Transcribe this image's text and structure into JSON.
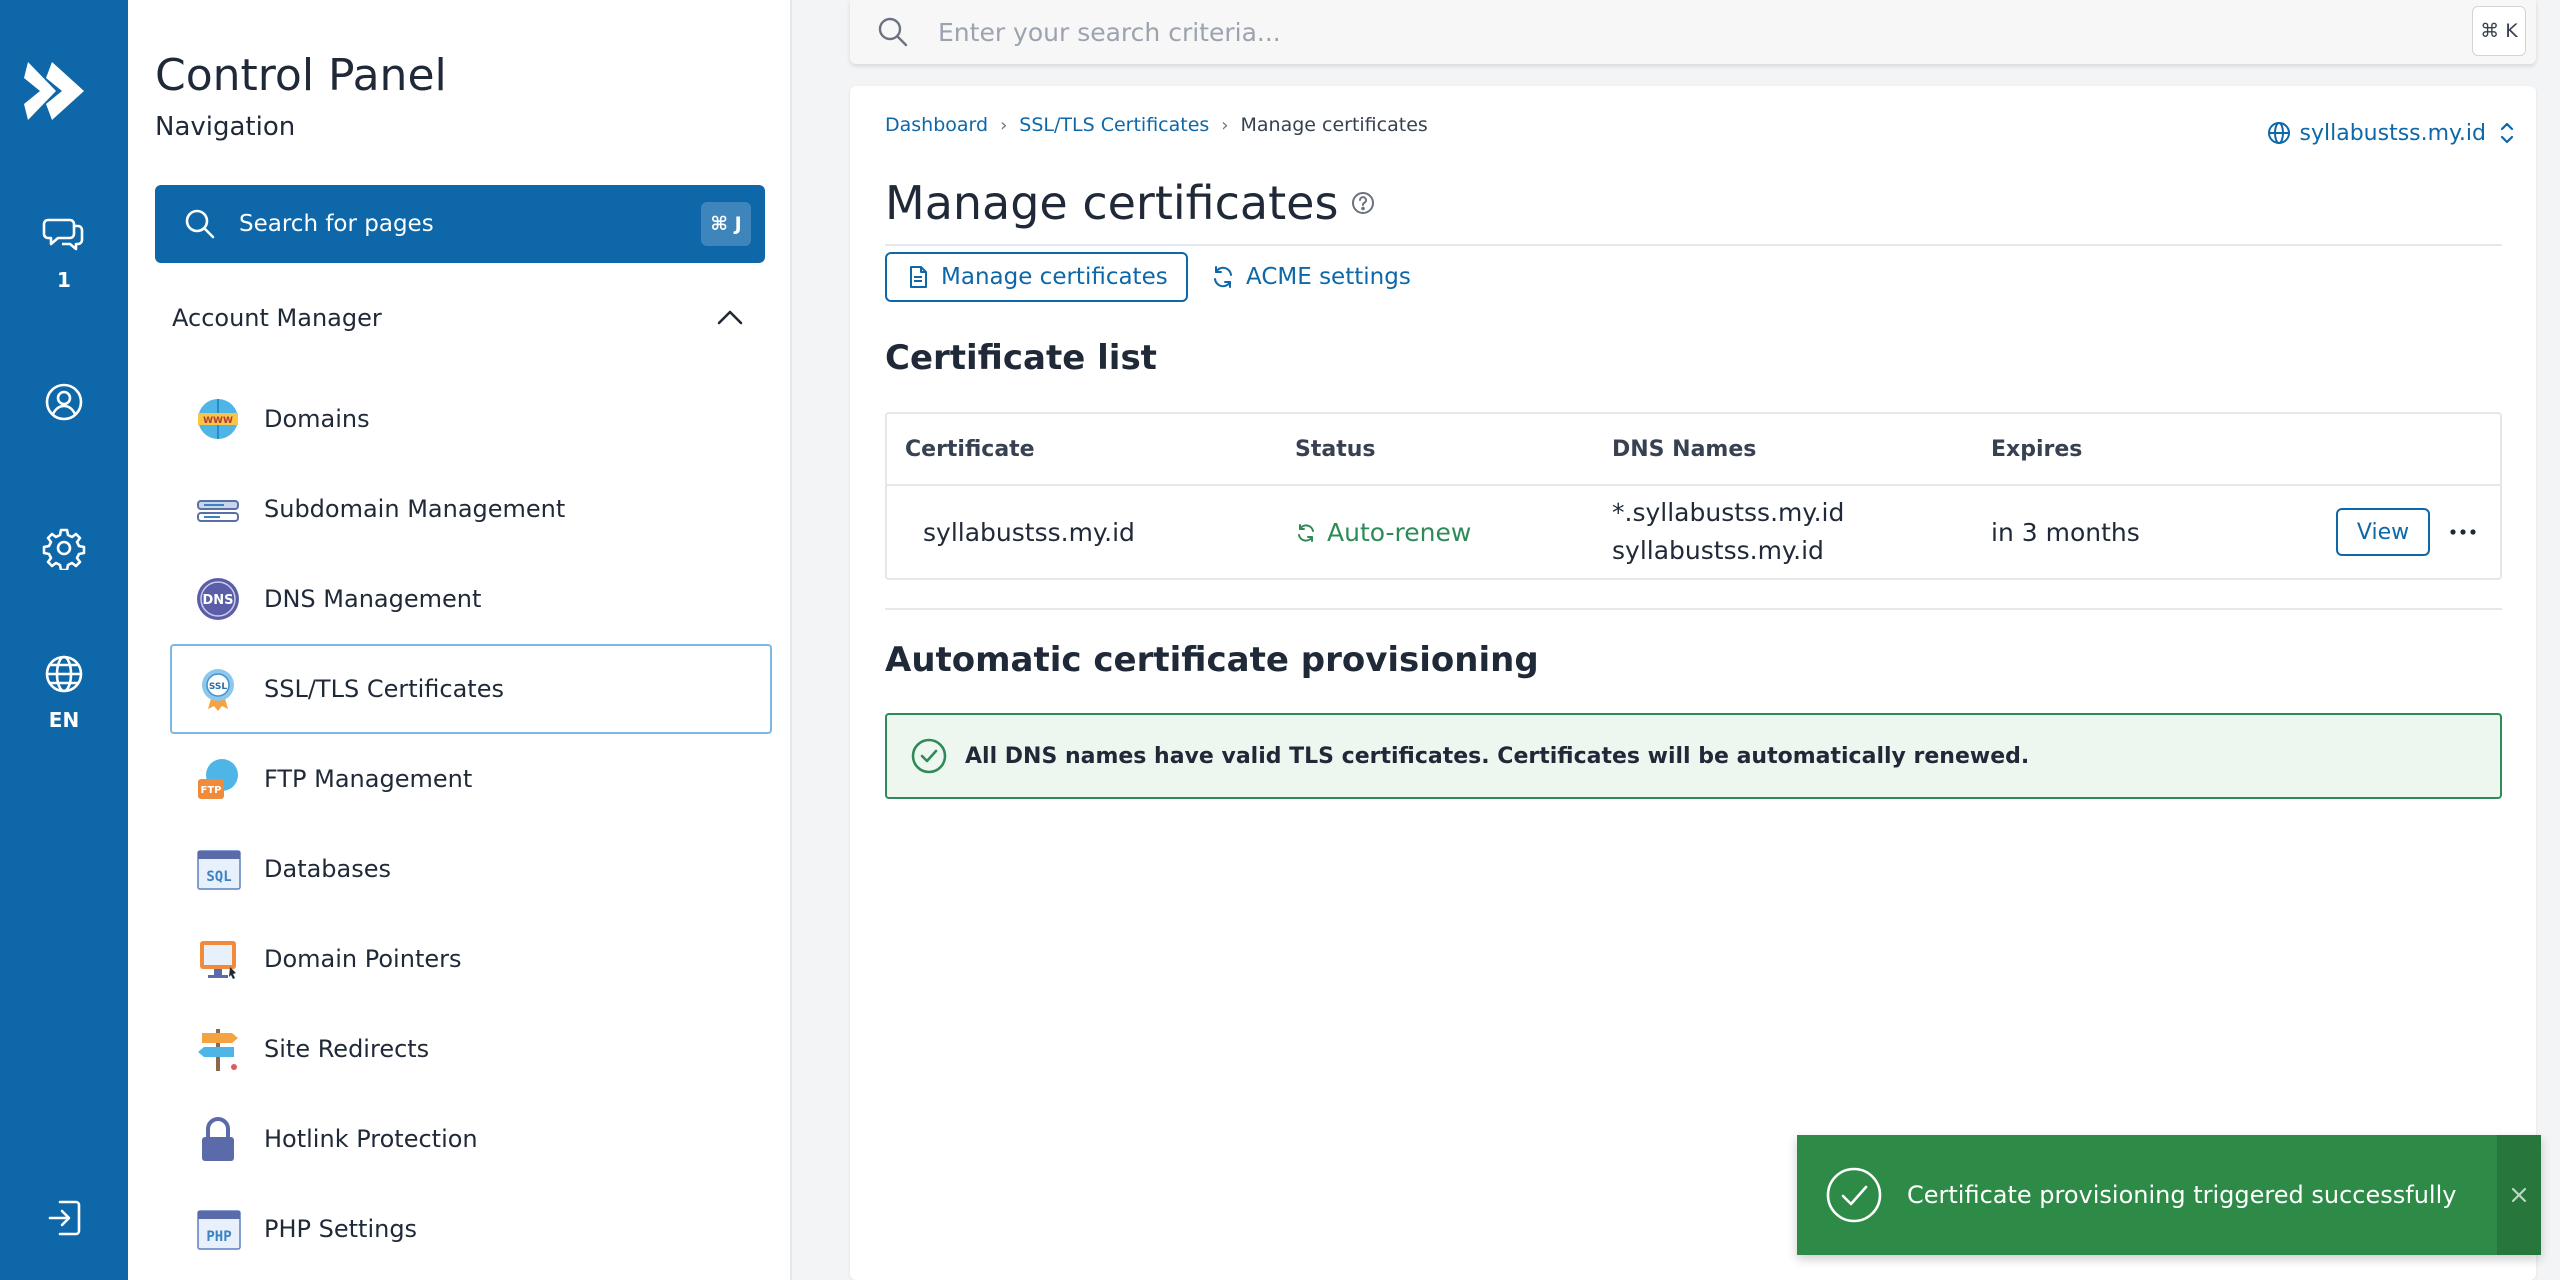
{
  "rail": {
    "messages_count": "1",
    "language": "EN"
  },
  "nav": {
    "title": "Control Panel",
    "subtitle": "Navigation",
    "search_label": "Search for pages",
    "search_shortcut": "⌘ J",
    "section_label": "Account Manager",
    "items": [
      {
        "label": "Domains",
        "icon": "domains-icon"
      },
      {
        "label": "Subdomain Management",
        "icon": "subdomain-icon"
      },
      {
        "label": "DNS Management",
        "icon": "dns-icon"
      },
      {
        "label": "SSL/TLS Certificates",
        "icon": "ssl-certificate-icon",
        "active": true
      },
      {
        "label": "FTP Management",
        "icon": "ftp-icon"
      },
      {
        "label": "Databases",
        "icon": "sql-database-icon"
      },
      {
        "label": "Domain Pointers",
        "icon": "domain-pointer-icon"
      },
      {
        "label": "Site Redirects",
        "icon": "signpost-icon"
      },
      {
        "label": "Hotlink Protection",
        "icon": "lock-icon"
      },
      {
        "label": "PHP Settings",
        "icon": "php-icon"
      }
    ]
  },
  "topbar": {
    "search_placeholder": "Enter your search criteria...",
    "search_shortcut": "⌘ K"
  },
  "breadcrumb": {
    "items": [
      "Dashboard",
      "SSL/TLS Certificates"
    ],
    "current": "Manage certificates"
  },
  "domain_selector": "syllabustss.my.id",
  "page": {
    "title": "Manage certificates",
    "tabs": [
      "Manage certificates",
      "ACME settings"
    ]
  },
  "certificate_list": {
    "title": "Certificate list",
    "columns": [
      "Certificate",
      "Status",
      "DNS Names",
      "Expires"
    ],
    "rows": [
      {
        "certificate": "syllabustss.my.id",
        "status": "Auto-renew",
        "dns_names": [
          "*.syllabustss.my.id",
          "syllabustss.my.id"
        ],
        "expires": "in 3 months",
        "action": "View"
      }
    ]
  },
  "provisioning": {
    "title": "Automatic certificate provisioning",
    "message": "All DNS names have valid TLS certificates. Certificates will be automatically renewed."
  },
  "toast": {
    "message": "Certificate provisioning triggered successfully"
  },
  "colors": {
    "brand": "#0e67a8",
    "success": "#2e8b57",
    "toast_bg": "#2e8b47"
  }
}
